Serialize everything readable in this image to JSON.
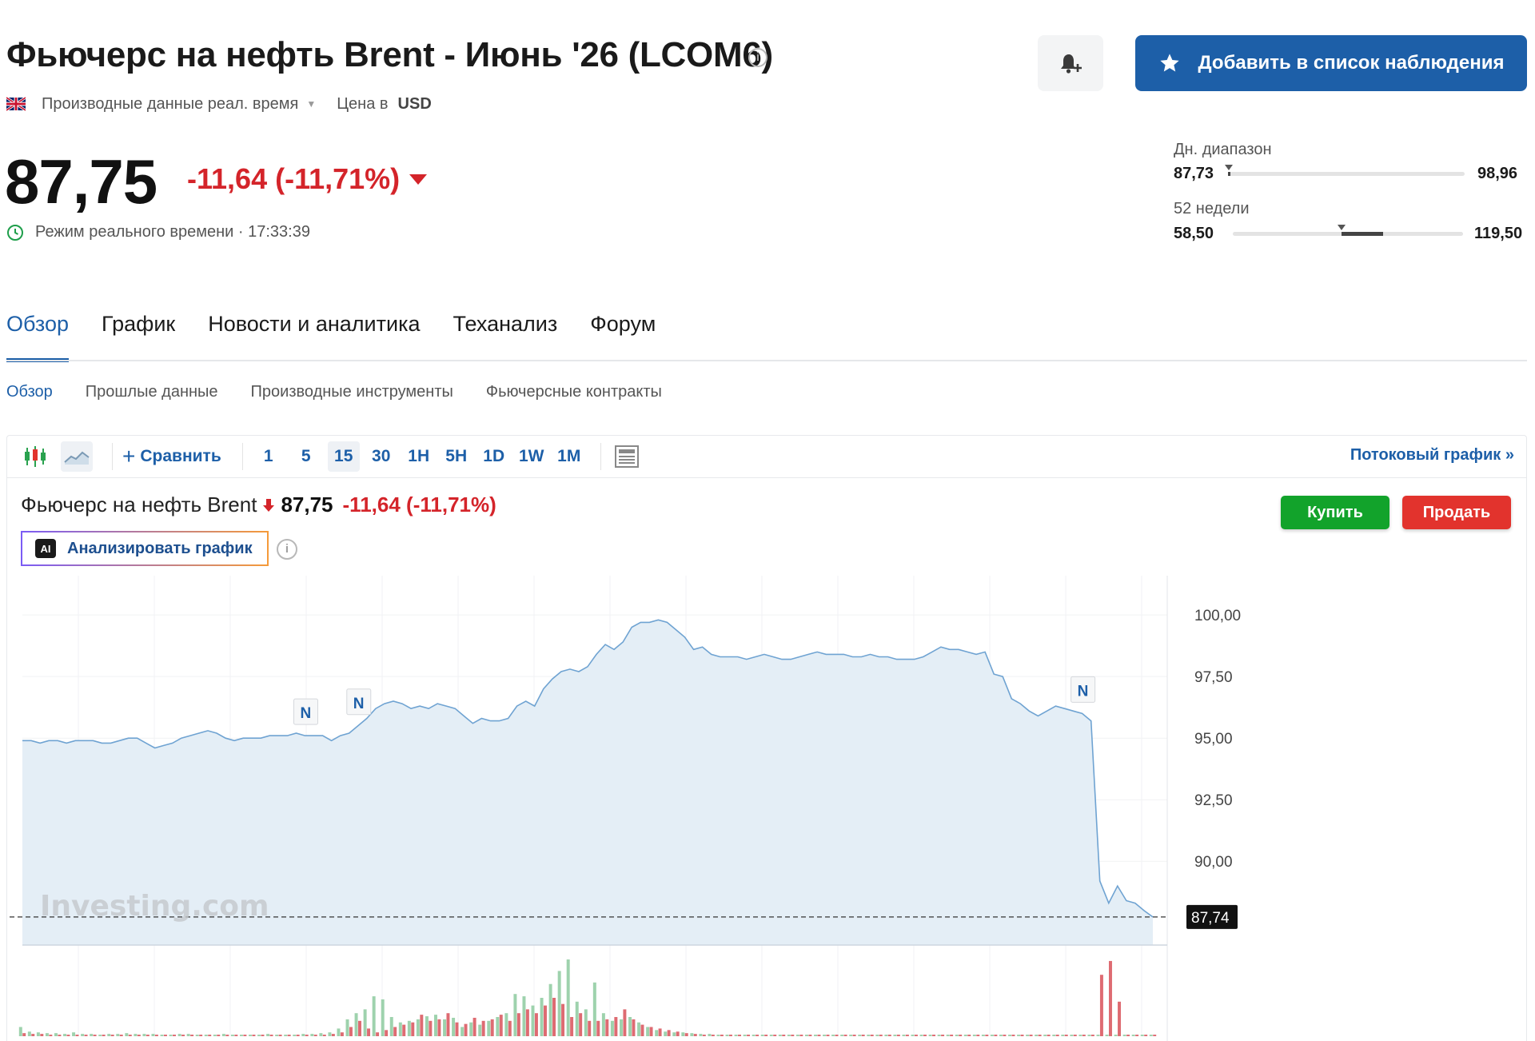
{
  "header": {
    "title": "Фьючерс на нефть Brent - Июнь '26 (LCOM6)",
    "info_icon": "info-icon",
    "data_source": "Производные данные реал. время",
    "currency_label": "Цена в",
    "currency": "USD",
    "watchlist_button": "Добавить в список наблюдения"
  },
  "quote": {
    "price": "87,75",
    "change": "-11,64 (-11,71%)",
    "realtime_label": "Режим реального времени · 17:33:39"
  },
  "ranges": {
    "day_label": "Дн. диапазон",
    "day_low": "87,73",
    "day_high": "98,96",
    "week52_label": "52 недели",
    "week52_low": "58,50",
    "week52_high": "119,50"
  },
  "tabs": [
    {
      "label": "Обзор",
      "active": true
    },
    {
      "label": "График",
      "active": false
    },
    {
      "label": "Новости и аналитика",
      "active": false
    },
    {
      "label": "Теханализ",
      "active": false
    },
    {
      "label": "Форум",
      "active": false
    }
  ],
  "subtabs": [
    {
      "label": "Обзор",
      "active": true
    },
    {
      "label": "Прошлые данные",
      "active": false
    },
    {
      "label": "Производные инструменты",
      "active": false
    },
    {
      "label": "Фьючерсные контракты",
      "active": false
    }
  ],
  "toolbar": {
    "compare": "Сравнить",
    "intervals": [
      "1",
      "5",
      "15",
      "30",
      "1H",
      "5H",
      "1D",
      "1W",
      "1M"
    ],
    "active_interval": "15",
    "stream_link": "Потоковый график »"
  },
  "chart_header": {
    "name": "Фьючерс на нефть Brent",
    "price": "87,75",
    "change": "-11,64",
    "change_pct": "(-11,71%)",
    "analyze_button": "Анализировать график",
    "buy": "Купить",
    "sell": "Продать"
  },
  "colors": {
    "accent": "#1d5fa8",
    "down": "#d4242a",
    "buy": "#12a32b",
    "sell": "#e2332d",
    "area_fill": "#e4eef6",
    "line": "#6fa3d2",
    "vol_up": "#9ed2ad",
    "vol_down": "#de6b72"
  },
  "chart_data": {
    "type": "area",
    "watermark": "Investing.com",
    "y_ticks": [
      "100,00",
      "97,50",
      "95,00",
      "92,50",
      "90,00"
    ],
    "y_tick_values": [
      100,
      97.5,
      95,
      92.5,
      90
    ],
    "ylim": [
      86.6,
      101.4
    ],
    "last_price_label": "87,74",
    "last_price": 87.74,
    "values": [
      94.9,
      94.9,
      94.8,
      94.9,
      94.9,
      94.8,
      94.9,
      94.9,
      94.9,
      94.8,
      94.8,
      94.9,
      95.0,
      95.0,
      94.8,
      94.6,
      94.7,
      94.8,
      95.0,
      95.1,
      95.2,
      95.3,
      95.2,
      95.0,
      94.9,
      95.0,
      95.0,
      95.0,
      95.1,
      95.1,
      95.1,
      95.2,
      95.1,
      95.1,
      95.1,
      94.9,
      95.1,
      95.2,
      95.5,
      95.8,
      96.2,
      96.4,
      96.5,
      96.4,
      96.2,
      96.3,
      96.2,
      96.4,
      96.3,
      96.2,
      95.9,
      95.6,
      95.8,
      95.7,
      95.7,
      95.8,
      96.3,
      96.5,
      96.3,
      97.0,
      97.4,
      97.7,
      97.8,
      97.7,
      97.9,
      98.4,
      98.8,
      98.6,
      98.9,
      99.5,
      99.7,
      99.7,
      99.8,
      99.7,
      99.4,
      99.1,
      98.6,
      98.7,
      98.4,
      98.3,
      98.3,
      98.3,
      98.2,
      98.3,
      98.4,
      98.3,
      98.2,
      98.2,
      98.3,
      98.4,
      98.5,
      98.4,
      98.4,
      98.4,
      98.3,
      98.3,
      98.4,
      98.3,
      98.3,
      98.2,
      98.2,
      98.2,
      98.3,
      98.5,
      98.7,
      98.6,
      98.6,
      98.5,
      98.4,
      98.5,
      97.6,
      97.5,
      96.6,
      96.4,
      96.1,
      95.9,
      96.1,
      96.3,
      96.2,
      96.1,
      96.0,
      95.7,
      89.2,
      88.3,
      89.0,
      88.4,
      88.3,
      88.0,
      87.74
    ],
    "news_markers": [
      {
        "label": "N",
        "index": 32
      },
      {
        "label": "N",
        "index": 38
      },
      {
        "label": "N",
        "index": 120
      }
    ],
    "volume_up": [
      0.12,
      0.06,
      0.05,
      0.04,
      0.04,
      0.03,
      0.05,
      0.03,
      0.03,
      0.02,
      0.03,
      0.03,
      0.04,
      0.03,
      0.03,
      0.03,
      0.02,
      0.02,
      0.03,
      0.03,
      0.02,
      0.02,
      0.02,
      0.03,
      0.02,
      0.02,
      0.02,
      0.02,
      0.03,
      0.02,
      0.02,
      0.02,
      0.03,
      0.03,
      0.04,
      0.05,
      0.1,
      0.22,
      0.3,
      0.35,
      0.52,
      0.48,
      0.25,
      0.18,
      0.2,
      0.22,
      0.26,
      0.28,
      0.22,
      0.24,
      0.12,
      0.18,
      0.15,
      0.2,
      0.25,
      0.3,
      0.55,
      0.52,
      0.4,
      0.5,
      0.68,
      0.85,
      1.0,
      0.45,
      0.35,
      0.7,
      0.3,
      0.2,
      0.22,
      0.25,
      0.18,
      0.12,
      0.08,
      0.06,
      0.05,
      0.05,
      0.04,
      0.03,
      0.03,
      0.02,
      0.02,
      0.02,
      0.02,
      0.02,
      0.02,
      0.02,
      0.02,
      0.02,
      0.02,
      0.02,
      0.02,
      0.02,
      0.02,
      0.02,
      0.02,
      0.02,
      0.02,
      0.02,
      0.02,
      0.02,
      0.02,
      0.02,
      0.02,
      0.02,
      0.02,
      0.02,
      0.02,
      0.02,
      0.02,
      0.02,
      0.02,
      0.02,
      0.02,
      0.02,
      0.02,
      0.02,
      0.02,
      0.02,
      0.02,
      0.02,
      0.02,
      0.02,
      0.02,
      0.02,
      0.02,
      0.02,
      0.02,
      0.02,
      0.02
    ],
    "volume_down": [
      0.04,
      0.03,
      0.03,
      0.02,
      0.02,
      0.02,
      0.02,
      0.02,
      0.02,
      0.02,
      0.02,
      0.02,
      0.02,
      0.02,
      0.02,
      0.02,
      0.02,
      0.02,
      0.02,
      0.02,
      0.02,
      0.02,
      0.02,
      0.02,
      0.02,
      0.02,
      0.02,
      0.02,
      0.02,
      0.02,
      0.02,
      0.02,
      0.02,
      0.02,
      0.02,
      0.03,
      0.05,
      0.12,
      0.2,
      0.1,
      0.05,
      0.08,
      0.12,
      0.15,
      0.18,
      0.28,
      0.2,
      0.22,
      0.3,
      0.18,
      0.16,
      0.24,
      0.2,
      0.22,
      0.28,
      0.2,
      0.3,
      0.35,
      0.3,
      0.4,
      0.5,
      0.42,
      0.25,
      0.3,
      0.2,
      0.2,
      0.22,
      0.25,
      0.35,
      0.22,
      0.15,
      0.12,
      0.1,
      0.08,
      0.06,
      0.04,
      0.03,
      0.02,
      0.02,
      0.02,
      0.02,
      0.02,
      0.02,
      0.02,
      0.02,
      0.02,
      0.02,
      0.02,
      0.02,
      0.02,
      0.02,
      0.02,
      0.02,
      0.02,
      0.02,
      0.02,
      0.02,
      0.02,
      0.02,
      0.02,
      0.02,
      0.02,
      0.02,
      0.02,
      0.02,
      0.02,
      0.02,
      0.02,
      0.02,
      0.02,
      0.02,
      0.02,
      0.02,
      0.02,
      0.02,
      0.02,
      0.02,
      0.02,
      0.02,
      0.02,
      0.02,
      0.02,
      0.8,
      0.98,
      0.45,
      0.02,
      0.02,
      0.02,
      0.02
    ]
  }
}
